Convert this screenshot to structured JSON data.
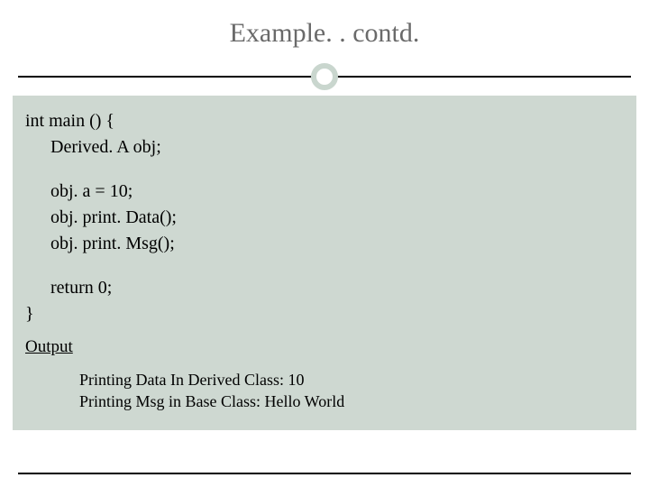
{
  "title": "Example. . contd.",
  "code": {
    "l1": "int main () {",
    "l2": "Derived. A   obj;",
    "l3": "obj. a = 10;",
    "l4": "obj. print. Data();",
    "l5": "obj. print. Msg();",
    "l6": "return 0;",
    "l7": "}"
  },
  "output_label": "Output",
  "output": {
    "o1": "Printing Data In Derived Class: 10",
    "o2": "Printing Msg in Base Class: Hello World"
  }
}
